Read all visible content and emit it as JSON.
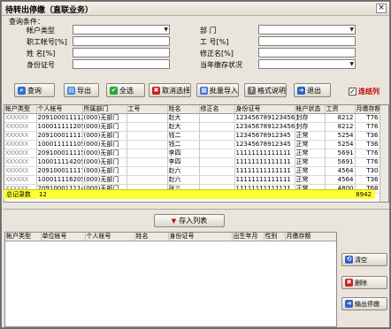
{
  "window": {
    "title": "待转出停缴（直联业务）",
    "close": "×"
  },
  "criteria": {
    "heading": "查询条件：",
    "fields": {
      "account_type": {
        "label": "帐户类型",
        "value": ""
      },
      "staff_no": {
        "label": "职工帐号[%]",
        "value": ""
      },
      "name": {
        "label": "姓  名[%]",
        "value": ""
      },
      "id_no": {
        "label": "身份证号",
        "value": ""
      },
      "department": {
        "label": "部      门",
        "value": ""
      },
      "work_no": {
        "label": "工  号[%]",
        "value": ""
      },
      "corrected_name": {
        "label": "修正名[%]",
        "value": ""
      },
      "current_status": {
        "label": "当年缴存状况",
        "value": ""
      }
    }
  },
  "toolbar": {
    "query": "查询",
    "export": "导出",
    "select_all": "全选",
    "cancel_select": "取消选择",
    "batch_import": "批量导入",
    "format_help": "格式说明",
    "exit": "退出",
    "merge_columns": "连结列"
  },
  "main_table": {
    "columns": [
      "帐户类型",
      "个人帐号",
      "所属部门",
      "工号",
      "姓名",
      "修正名",
      "身份证号",
      "帐户状态",
      "工资",
      "月缴存额"
    ],
    "rows": [
      [
        "XXXXXX",
        "209100011112",
        "(000)无部门",
        "",
        "赵大",
        "",
        "12345678912345678",
        "封存",
        "8212",
        "T76"
      ],
      [
        "XXXXXX",
        "100011111205",
        "(000)无部门",
        "",
        "赵大",
        "",
        "12345678912345678",
        "封存",
        "8212",
        "T76"
      ],
      [
        "XXXXXX",
        "209100011111",
        "(000)无部门",
        "",
        "钱二",
        "",
        "12345678912345",
        "正常",
        "5254",
        "T36"
      ],
      [
        "XXXXXX",
        "100011111105",
        "(000)无部门",
        "",
        "钱二",
        "",
        "12345678912345",
        "正常",
        "5254",
        "T36"
      ],
      [
        "XXXXXX",
        "209100011115",
        "(000)无部门",
        "",
        "李四",
        "",
        "11111111111111",
        "正常",
        "5691",
        "T76"
      ],
      [
        "XXXXXX",
        "100011114205",
        "(000)无部门",
        "",
        "李四",
        "",
        "11111111111111",
        "正常",
        "5691",
        "T76"
      ],
      [
        "XXXXXX",
        "209100011117",
        "(000)无部门",
        "",
        "赵六",
        "",
        "11111111111111",
        "正常",
        "4564",
        "T30"
      ],
      [
        "XXXXXX",
        "100011116205",
        "(000)无部门",
        "",
        "赵六",
        "",
        "11111111111111",
        "正常",
        "4564",
        "T36"
      ],
      [
        "XXXXXX",
        "209100011114",
        "(000)无部门",
        "",
        "张三",
        "",
        "11111111111111",
        "正常",
        "4800",
        "T68"
      ]
    ],
    "summary_label": "总记录数",
    "summary_count": "12",
    "summary_total": "8942"
  },
  "save_button": "存入列表",
  "list_table": {
    "columns": [
      "帐户类型",
      "单位帐号",
      "个人帐号",
      "姓名",
      "身份证号",
      "出生年月",
      "性别",
      "月缴存额"
    ]
  },
  "side_buttons": {
    "clear": "清空",
    "delete": "删除",
    "output": "输出停缴"
  }
}
